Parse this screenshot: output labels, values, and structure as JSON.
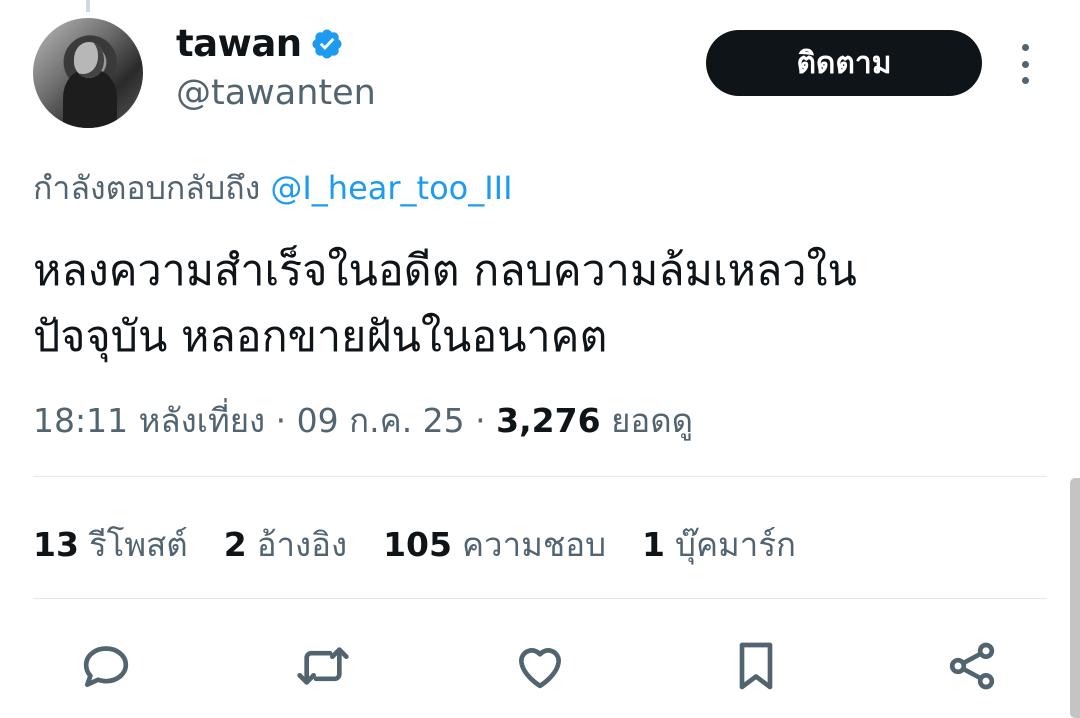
{
  "author": {
    "display_name": "tawan",
    "handle": "@tawanten",
    "verified": true
  },
  "follow_button": {
    "label": "ติดตาม"
  },
  "reply_context": {
    "prefix": "กำลังตอบกลับถึง",
    "mention": "@I_hear_too_III"
  },
  "tweet": {
    "text": "หลงความสำเร็จในอดีต กลบความล้มเหลวใน\nปัจจุบัน หลอกขายฝันในอนาคต",
    "time": "18:11 หลังเที่ยง",
    "separator": "·",
    "date": "09 ก.ค. 25",
    "views_count": "3,276",
    "views_label": "ยอดดู"
  },
  "stats": [
    {
      "count": "13",
      "label": "รีโพสต์"
    },
    {
      "count": "2",
      "label": "อ้างอิง"
    },
    {
      "count": "105",
      "label": "ความชอบ"
    },
    {
      "count": "1",
      "label": "บุ๊คมาร์ก"
    }
  ],
  "actions": [
    {
      "icon": "reply-icon"
    },
    {
      "icon": "repost-icon"
    },
    {
      "icon": "like-icon"
    },
    {
      "icon": "bookmark-icon"
    },
    {
      "icon": "share-icon"
    }
  ],
  "colors": {
    "accent": "#1d9bf0",
    "text_primary": "#0f1419",
    "text_secondary": "#536471",
    "button_bg": "#0f1419"
  }
}
